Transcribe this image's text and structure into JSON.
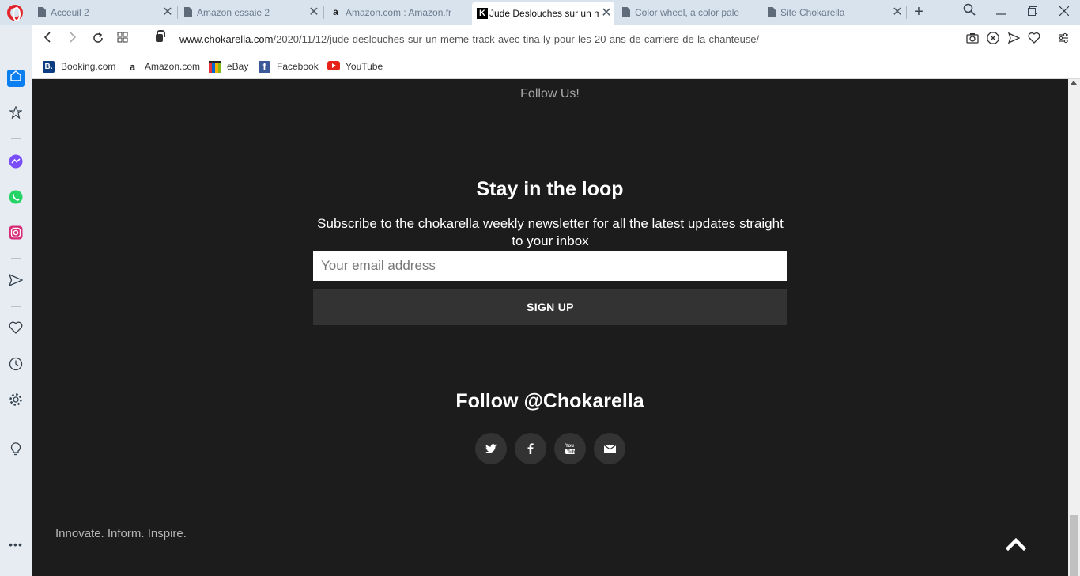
{
  "tabs": [
    {
      "title": "Acceuil 2",
      "icon": "page-icon"
    },
    {
      "title": "Amazon essaie 2",
      "icon": "page-icon"
    },
    {
      "title": "Amazon.com : Amazon.fr",
      "icon": "amazon-icon"
    },
    {
      "title": "Jude Deslouches sur un m",
      "icon": "chokarella-icon",
      "active": true
    },
    {
      "title": "Color wheel, a color pale",
      "icon": "page-icon"
    },
    {
      "title": "Site Chokarella",
      "icon": "page-icon"
    }
  ],
  "address": {
    "host": "www.chokarella.com",
    "path": "/2020/11/12/jude-deslouches-sur-un-meme-track-avec-tina-ly-pour-les-20-ans-de-carriere-de-la-chanteuse/"
  },
  "bookmarks": [
    {
      "label": "Booking.com",
      "icon_text": "B.",
      "color": "#0b3b80"
    },
    {
      "label": "Amazon.com",
      "icon_text": "a",
      "color": "#222222"
    },
    {
      "label": "eBay",
      "icon_text": "",
      "color": "#e53238"
    },
    {
      "label": "Facebook",
      "icon_text": "f",
      "color": "#3b5998"
    },
    {
      "label": "YouTube",
      "icon_text": "",
      "color": "#e62117"
    }
  ],
  "page": {
    "follow_us": "Follow Us!",
    "loop_title": "Stay in the loop",
    "loop_subtitle": "Subscribe to the chokarella weekly newsletter for all the latest updates straight to your inbox",
    "email_placeholder": "Your email address",
    "signup_label": "SIGN UP",
    "follow_title": "Follow @Chokarella",
    "tagline": "Innovate. Inform. Inspire."
  },
  "social": [
    "twitter-icon",
    "facebook-icon",
    "youtube-icon",
    "email-icon"
  ],
  "colors": {
    "page_bg": "#1c1c1c",
    "button_bg": "#333333",
    "sidebar_bg": "#e6ecf2",
    "tabstrip_bg": "#d9e3ee"
  }
}
